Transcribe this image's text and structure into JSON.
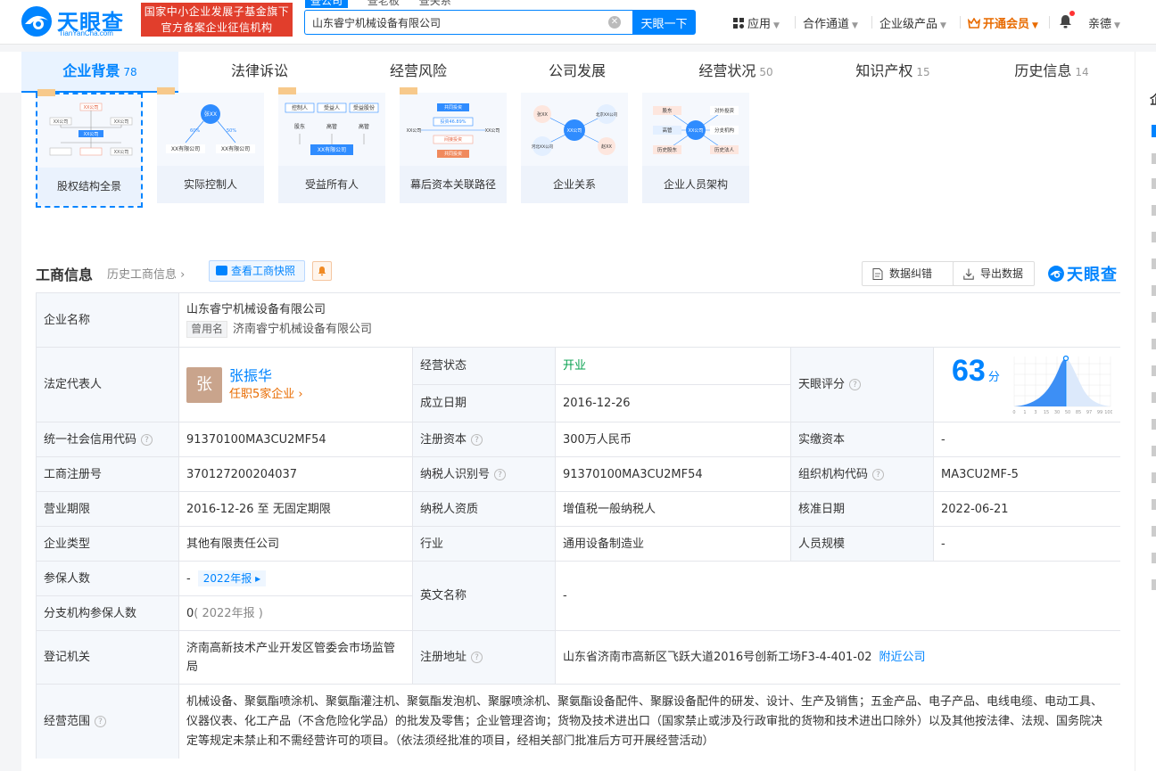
{
  "header": {
    "logo_text": "天眼查",
    "logo_sub": "TianYanCha.com",
    "gov_line1": "国家中小企业发展子基金旗下",
    "gov_line2": "官方备案企业征信机构",
    "search_tabs": [
      "查公司",
      "查老板",
      "查关系"
    ],
    "search_value": "山东睿宁机械设备有限公司",
    "search_button": "天眼一下",
    "nav": {
      "apps": "应用",
      "channel": "合作通道",
      "enterprise": "企业级产品",
      "vip": "开通会员",
      "user": "亲德"
    }
  },
  "tabs": [
    {
      "label": "企业背景",
      "count": "78"
    },
    {
      "label": "法律诉讼",
      "count": ""
    },
    {
      "label": "经营风险",
      "count": ""
    },
    {
      "label": "公司发展",
      "count": ""
    },
    {
      "label": "经营状况",
      "count": "50"
    },
    {
      "label": "知识产权",
      "count": "15"
    },
    {
      "label": "历史信息",
      "count": "14"
    }
  ],
  "right_panel": {
    "title": "企"
  },
  "graph_cards": [
    {
      "label": "股权结构全景",
      "img": [
        "XX公司",
        "XX公司",
        "XX公司",
        "XX公司",
        "XX公司"
      ]
    },
    {
      "label": "实际控制人",
      "img": [
        "张XX",
        "XX有限公司",
        "XX有限公司",
        "60%",
        "50%"
      ]
    },
    {
      "label": "受益所有人",
      "img": [
        "控制人",
        "受益人",
        "受益股份",
        "股东",
        "高管",
        "高管",
        "XX有限公司"
      ]
    },
    {
      "label": "幕后资本关联路径",
      "img": [
        "共同投资",
        "投资46.89%",
        "XX公司",
        "XX公司",
        "间接投资",
        "共同投资"
      ]
    },
    {
      "label": "企业关系",
      "img": [
        "张XX",
        "北京XX公司",
        "XX公司",
        "河北XX公司",
        "赵XX"
      ]
    },
    {
      "label": "企业人员架构",
      "img": [
        "股东",
        "对外投资",
        "高管",
        "XX公司",
        "分支机构",
        "历史股东",
        "历史法人"
      ]
    }
  ],
  "section": {
    "title": "工商信息",
    "history": "历史工商信息",
    "snapshot": "查看工商快照",
    "correct": "数据纠错",
    "export": "导出数据",
    "brand": "天眼查"
  },
  "info": {
    "name_label": "企业名称",
    "name": "山东睿宁机械设备有限公司",
    "former_tag": "曾用名",
    "former_name": "济南睿宁机械设备有限公司",
    "rep_label": "法定代表人",
    "rep_avatar": "张",
    "rep_name": "张振华",
    "rep_sub": "任职5家企业",
    "status_label": "经营状态",
    "status": "开业",
    "founded_label": "成立日期",
    "founded": "2016-12-26",
    "score_label": "天眼评分",
    "score": "63",
    "score_unit": "分",
    "score_axis": [
      "0",
      "1",
      "3",
      "15",
      "30",
      "50",
      "85",
      "97",
      "99",
      "100"
    ],
    "credit_label": "统一社会信用代码",
    "credit": "91370100MA3CU2MF54",
    "capital_label": "注册资本",
    "capital": "300万人民币",
    "paid_label": "实缴资本",
    "paid": "-",
    "reg_no_label": "工商注册号",
    "reg_no": "370127200204037",
    "tax_id_label": "纳税人识别号",
    "tax_id": "91370100MA3CU2MF54",
    "org_code_label": "组织机构代码",
    "org_code": "MA3CU2MF-5",
    "term_label": "营业期限",
    "term": "2016-12-26 至 无固定期限",
    "tax_qual_label": "纳税人资质",
    "tax_qual": "增值税一般纳税人",
    "approve_label": "核准日期",
    "approve": "2022-06-21",
    "type_label": "企业类型",
    "type": "其他有限责任公司",
    "industry_label": "行业",
    "industry": "通用设备制造业",
    "staff_label": "人员规模",
    "staff": "-",
    "insured_label": "参保人数",
    "insured": "-",
    "insured_tag": "2022年报",
    "en_name_label": "英文名称",
    "en_name": "-",
    "branch_insured_label": "分支机构参保人数",
    "branch_insured": "0",
    "branch_insured_note": "( 2022年报 )",
    "authority_label": "登记机关",
    "authority": "济南高新技术产业开发区管委会市场监管局",
    "address_label": "注册地址",
    "address": "山东省济南市高新区飞跃大道2016号创新工场F3-4-401-02",
    "address_link": "附近公司",
    "scope_label": "经营范围",
    "scope": "机械设备、聚氨酯喷涂机、聚氨酯灌注机、聚氨酯发泡机、聚脲喷涂机、聚氨酯设备配件、聚脲设备配件的研发、设计、生产及销售；五金产品、电子产品、电线电缆、电动工具、仪器仪表、化工产品（不含危险化学品）的批发及零售；企业管理咨询；货物及技术进出口（国家禁止或涉及行政审批的货物和技术进出口除外）以及其他按法律、法规、国务院决定等规定未禁止和不需经营许可的项目。（依法须经批准的项目，经相关部门批准后方可开展经营活动）"
  },
  "colors": {
    "accent": "#0084ff",
    "vip": "#e86b00",
    "gov": "#e13e2c",
    "open": "#06a04e"
  }
}
